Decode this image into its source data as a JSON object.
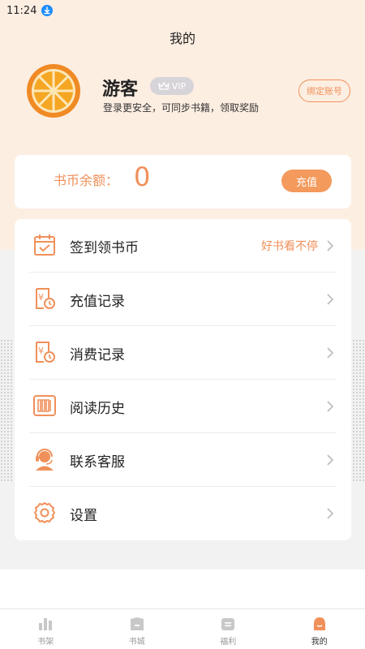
{
  "status_bar": {
    "time": "11:24"
  },
  "header": {
    "title": "我的"
  },
  "profile": {
    "username": "游客",
    "vip_label": "VIP",
    "login_tip": "登录更安全，可同步书籍，领取奖励",
    "bind_button": "绑定账号"
  },
  "balance": {
    "label": "书币余额：",
    "value": "0",
    "recharge_button": "充值"
  },
  "menu": {
    "items": [
      {
        "label": "签到领书币",
        "extra": "好书看不停",
        "icon": "calendar-check-icon"
      },
      {
        "label": "充值记录",
        "extra": "",
        "icon": "recharge-record-icon"
      },
      {
        "label": "消费记录",
        "extra": "",
        "icon": "consume-record-icon"
      },
      {
        "label": "阅读历史",
        "extra": "",
        "icon": "reading-history-icon"
      },
      {
        "label": "联系客服",
        "extra": "",
        "icon": "customer-service-icon"
      },
      {
        "label": "设置",
        "extra": "",
        "icon": "gear-icon"
      }
    ]
  },
  "tab_bar": {
    "items": [
      {
        "label": "书架",
        "icon": "bookshelf-icon"
      },
      {
        "label": "书城",
        "icon": "bookstore-icon"
      },
      {
        "label": "福利",
        "icon": "welfare-icon"
      },
      {
        "label": "我的",
        "icon": "profile-icon",
        "active": true
      }
    ]
  },
  "colors": {
    "accent": "#f0905a",
    "header_bg": "#fdeee2",
    "page_bg": "#f2f2f2"
  }
}
